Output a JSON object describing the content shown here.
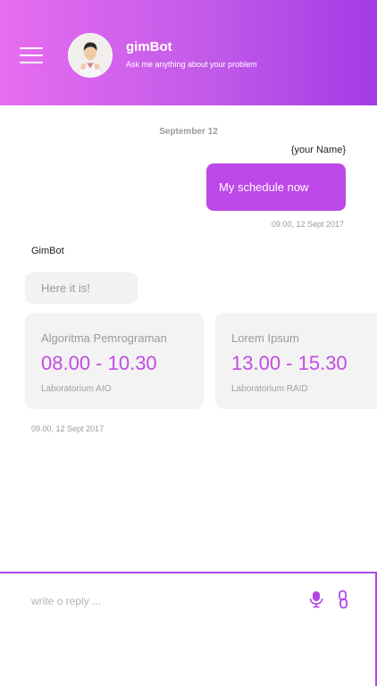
{
  "header": {
    "title": "gimBot",
    "subtitle": "Ask me anything about your problem",
    "menu_icon": "hamburger-menu-icon",
    "gradient": [
      "#e76df0",
      "#a43be6"
    ]
  },
  "chat": {
    "date_separator": "September 12",
    "user_message": {
      "sender": "{your Name}",
      "text": "My schedule now",
      "time": "09.00, 12 Sept 2017",
      "bubble_color": "#bd49ea"
    },
    "bot_message": {
      "sender": "GimBot",
      "text": "Here it is!",
      "time": "09.00, 12 Sept 2017"
    },
    "schedule_cards": [
      {
        "title": "Algoritma Pemrograman",
        "time": "08.00 - 10.30",
        "room": "Laboratorium AIO"
      },
      {
        "title": "Lorem Ipsum",
        "time": "13.00 - 15.30",
        "room": "Laboratorium RAID"
      }
    ],
    "accent_color": "#c34be6"
  },
  "composer": {
    "placeholder": "write o reply ...",
    "value": "",
    "icons": [
      "microphone-icon",
      "link-icon"
    ]
  }
}
